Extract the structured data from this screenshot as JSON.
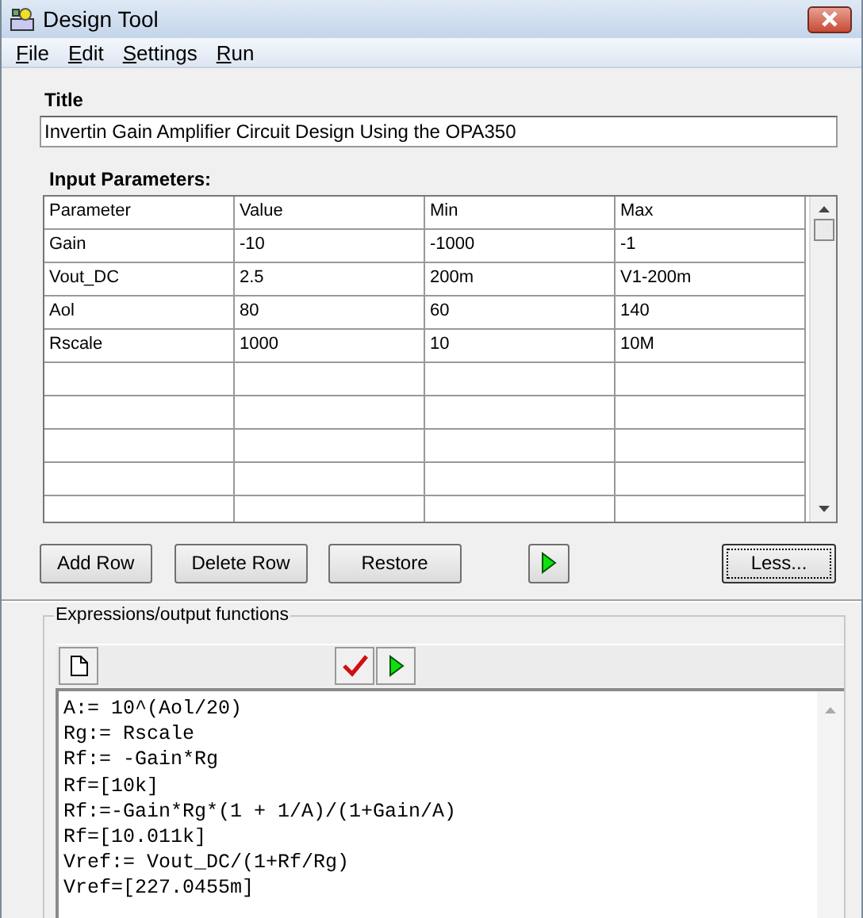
{
  "window": {
    "title": "Design Tool"
  },
  "menu": [
    "File",
    "Edit",
    "Settings",
    "Run"
  ],
  "title_field": {
    "label": "Title",
    "value": "Invertin Gain Amplifier Circuit Design Using the OPA350"
  },
  "parameters": {
    "label": "Input Parameters:",
    "columns": [
      "Parameter",
      "Value",
      "Min",
      "Max"
    ],
    "rows": [
      [
        "Gain",
        "-10",
        "-1000",
        "-1"
      ],
      [
        "Vout_DC",
        "2.5",
        "200m",
        "V1-200m"
      ],
      [
        "Aol",
        "80",
        "60",
        "140"
      ],
      [
        "Rscale",
        "1000",
        "10",
        "10M"
      ]
    ]
  },
  "buttons": [
    {
      "kind": "text",
      "label": "Add Row"
    },
    {
      "kind": "text",
      "label": "Delete Row"
    },
    {
      "kind": "text",
      "label": "Restore"
    },
    {
      "kind": "run"
    },
    {
      "kind": "text",
      "label": "Less...",
      "focused": true
    }
  ],
  "expressions": {
    "label": "Expressions/output functions",
    "lines": [
      "A:= 10^(Aol/20)",
      "Rg:= Rscale",
      "Rf:= -Gain*Rg",
      "Rf=[10k]",
      "Rf:=-Gain*Rg*(1 + 1/A)/(1+Gain/A)",
      "Rf=[10.011k]",
      "Vref:= Vout_DC/(1+Rf/Rg)",
      "Vref=[227.0455m]"
    ]
  }
}
